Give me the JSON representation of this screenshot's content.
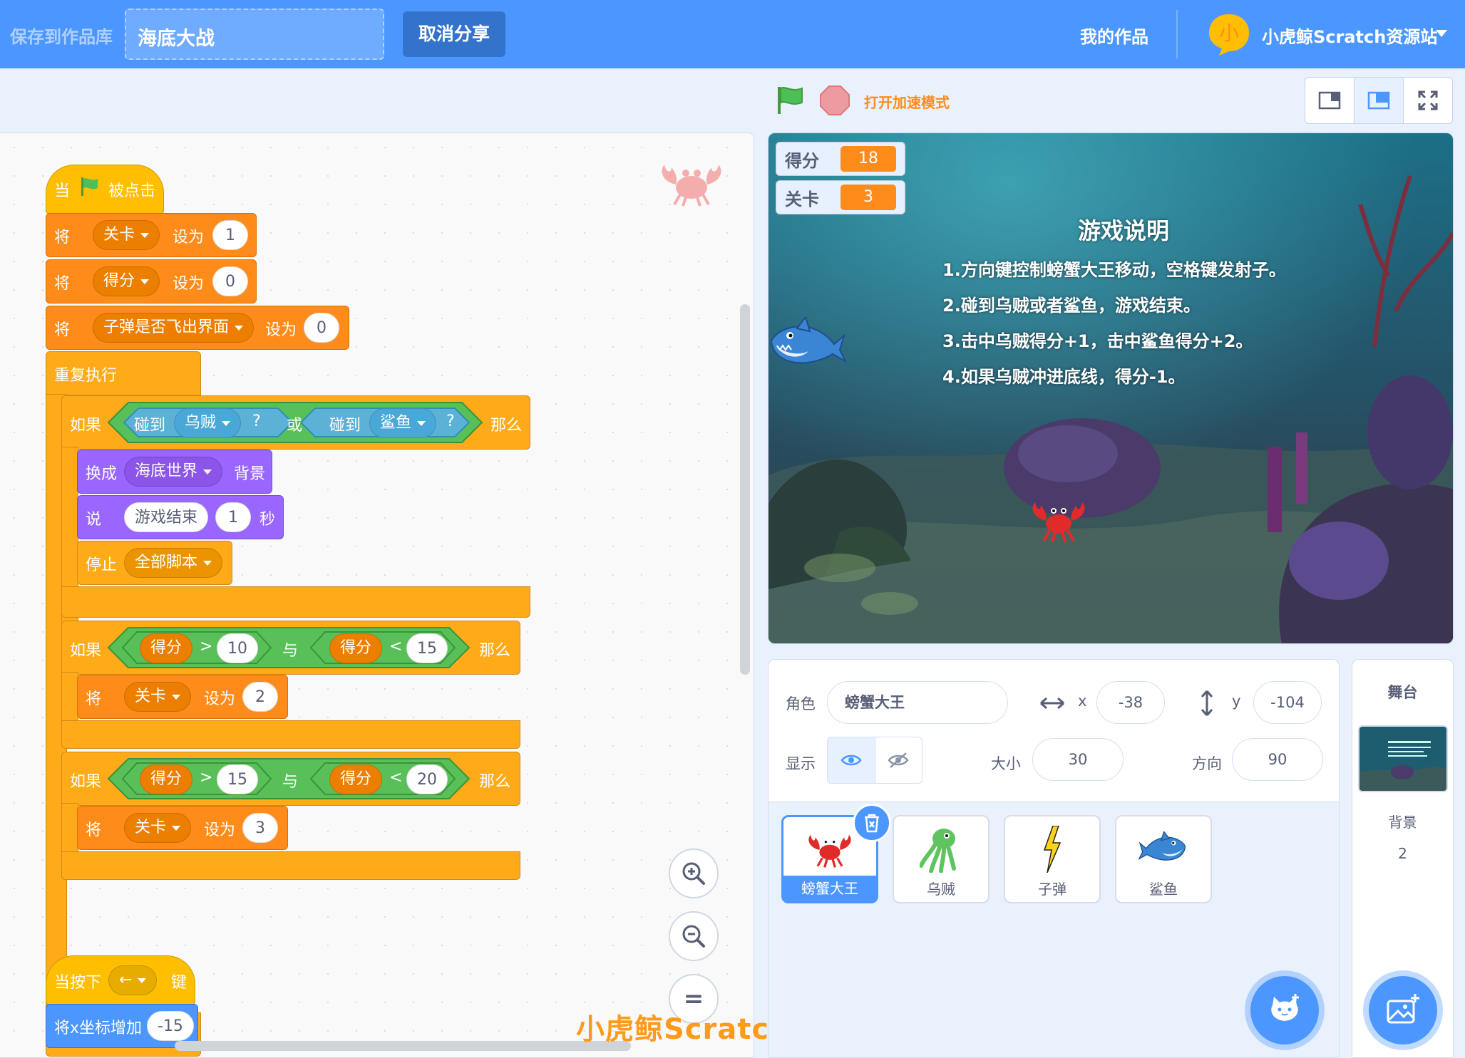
{
  "menubar": {
    "save_to_library": "保存到作品库",
    "project_title": "海底大战",
    "unshare": "取消分享",
    "my_stuff": "我的作品",
    "username": "小虎鲸Scratch资源站",
    "avatar_glyph": "小"
  },
  "controls": {
    "turbo_label": "打开加速模式"
  },
  "colors": {
    "menu_blue": "#4c97ff",
    "events": "#ffbf00",
    "control": "#ffab19",
    "variables": "#ff8c1a",
    "looks": "#9966ff",
    "operators": "#59c059",
    "sensing": "#5cb1d6"
  },
  "code": {
    "script1": {
      "hat": {
        "when": "当",
        "clicked": "被点击"
      },
      "set1": {
        "set": "将",
        "var": "关卡",
        "to": "设为",
        "val": "1"
      },
      "set2": {
        "set": "将",
        "var": "得分",
        "to": "设为",
        "val": "0"
      },
      "set3": {
        "set": "将",
        "var": "子弹是否飞出界面",
        "to": "设为",
        "val": "0"
      },
      "forever": "重复执行",
      "if1": {
        "if": "如果",
        "then": "那么",
        "or": "或",
        "touch_a": "碰到",
        "sprite_a": "乌贼",
        "q_a": "?",
        "touch_b": "碰到",
        "sprite_b": "鲨鱼",
        "q_b": "?",
        "switch": "换成",
        "backdrop": "海底世界",
        "backdrop_word": "背景",
        "say": "说",
        "msg": "游戏结束",
        "secs": "1",
        "secs_word": "秒",
        "stop": "停止",
        "stop_opt": "全部脚本"
      },
      "if2": {
        "if": "如果",
        "then": "那么",
        "and": "与",
        "var_a": "得分",
        "op_a": ">",
        "val_a": "10",
        "var_b": "得分",
        "op_b": "<",
        "val_b": "15",
        "set": "将",
        "var": "关卡",
        "to": "设为",
        "val": "2"
      },
      "if3": {
        "if": "如果",
        "then": "那么",
        "and": "与",
        "var_a": "得分",
        "op_a": ">",
        "val_a": "15",
        "var_b": "得分",
        "op_b": "<",
        "val_b": "20",
        "set": "将",
        "var": "关卡",
        "to": "设为",
        "val": "3"
      },
      "loop_arrow": "↺"
    },
    "script2": {
      "when_key": "当按下",
      "key": "←",
      "key_word": "键",
      "change_x": "将x坐标增加",
      "change_val": "-15"
    },
    "zoom": {
      "in": "zoom-in",
      "out": "zoom-out",
      "reset": "="
    },
    "watermark": "小虎鲸Scratch资源站"
  },
  "stage": {
    "monitors": [
      {
        "name": "得分",
        "value": "18"
      },
      {
        "name": "关卡",
        "value": "3"
      }
    ],
    "instructions_title": "游戏说明",
    "instructions": [
      "1.方向键控制螃蟹大王移动，空格键发射子。",
      "2.碰到乌贼或者鲨鱼，游戏结束。",
      "3.击中乌贼得分+1，击中鲨鱼得分+2。",
      "4.如果乌贼冲进底线，得分-1。"
    ]
  },
  "sprite_info": {
    "sprite_label": "角色",
    "sprite_name": "螃蟹大王",
    "x_label": "x",
    "x": "-38",
    "y_label": "y",
    "y": "-104",
    "show_label": "显示",
    "size_label": "大小",
    "size": "30",
    "direction_label": "方向",
    "direction": "90"
  },
  "sprites": [
    {
      "name": "螃蟹大王",
      "icon": "crab-icon",
      "selected": true
    },
    {
      "name": "乌贼",
      "icon": "squid-icon",
      "selected": false
    },
    {
      "name": "子弹",
      "icon": "lightning-icon",
      "selected": false
    },
    {
      "name": "鲨鱼",
      "icon": "shark-icon",
      "selected": false
    }
  ],
  "stage_pane": {
    "title": "舞台",
    "backdrops_label": "背景",
    "backdrops_count": "2"
  }
}
